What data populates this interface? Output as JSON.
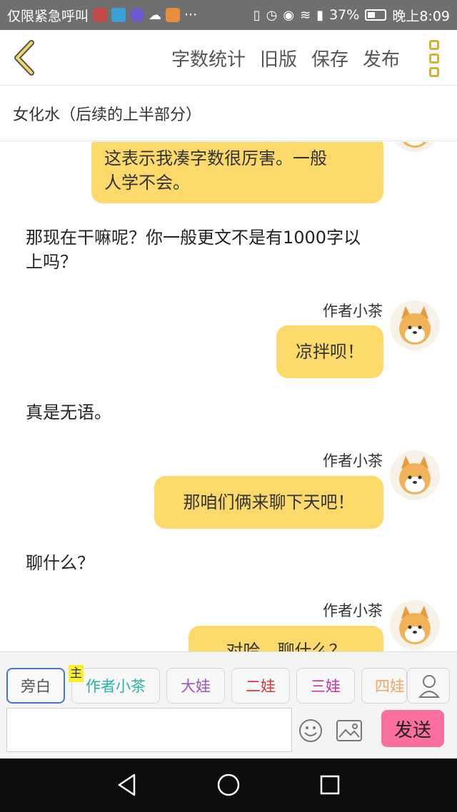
{
  "status_bar": {
    "left_text": "仅限紧急呼叫",
    "more": "···",
    "battery": "37%",
    "time": "晚上8:09"
  },
  "header": {
    "actions": [
      "字数统计",
      "旧版",
      "保存",
      "发布"
    ]
  },
  "document_title": "女化水（后续的上半部分）",
  "chat": {
    "messages": [
      {
        "type": "bubble-partial",
        "lines": [
          "这表示我凑字数很厉害。一般",
          "人学不会。"
        ]
      },
      {
        "type": "narration",
        "lines": [
          "那现在干嘛呢？你一般更文不是有1000字以",
          "上吗？"
        ]
      },
      {
        "type": "author",
        "name": "作者小茶",
        "text": "凉拌呗！"
      },
      {
        "type": "narration",
        "lines": [
          "真是无语。"
        ]
      },
      {
        "type": "author",
        "name": "作者小茶",
        "text": "那咱们俩来聊下天吧！"
      },
      {
        "type": "narration",
        "lines": [
          "聊什么？"
        ]
      },
      {
        "type": "author",
        "name": "作者小茶",
        "text": "对哈，聊什么？"
      }
    ]
  },
  "composer": {
    "roles": [
      {
        "label": "旁白",
        "color": "#555555"
      },
      {
        "label": "作者小茶",
        "color": "#2ab3a6"
      },
      {
        "label": "大娃",
        "color": "#9b59b6"
      },
      {
        "label": "二娃",
        "color": "#d9383a"
      },
      {
        "label": "三娃",
        "color": "#c2379b"
      },
      {
        "label": "四娃",
        "color": "#e8a868"
      }
    ],
    "main_badge": "主",
    "send_label": "发送",
    "input_value": ""
  },
  "colors": {
    "bubble": "#fbd96a",
    "send": "#fa6f9c",
    "accent": "#d3b13a"
  }
}
